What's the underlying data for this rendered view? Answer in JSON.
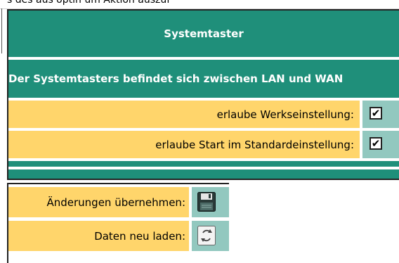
{
  "top_cut_text": "s des aus optin um Aktion auszuf",
  "header": {
    "title": "Systemtaster"
  },
  "description": "Der Systemtasters befindet sich zwischen LAN und WAN",
  "options": [
    {
      "label": "erlaube Werkseinstellung:",
      "checked": true,
      "mark": "✔"
    },
    {
      "label": "erlaube Start im Standardeinstellung:",
      "checked": true,
      "mark": "✔"
    }
  ],
  "actions": [
    {
      "label": "Änderungen übernehmen:",
      "icon": "save-icon"
    },
    {
      "label": "Daten neu laden:",
      "icon": "reload-icon"
    }
  ],
  "colors": {
    "teal": "#1f8f7a",
    "light_teal": "#92c8bf",
    "yellow": "#ffd56b"
  }
}
